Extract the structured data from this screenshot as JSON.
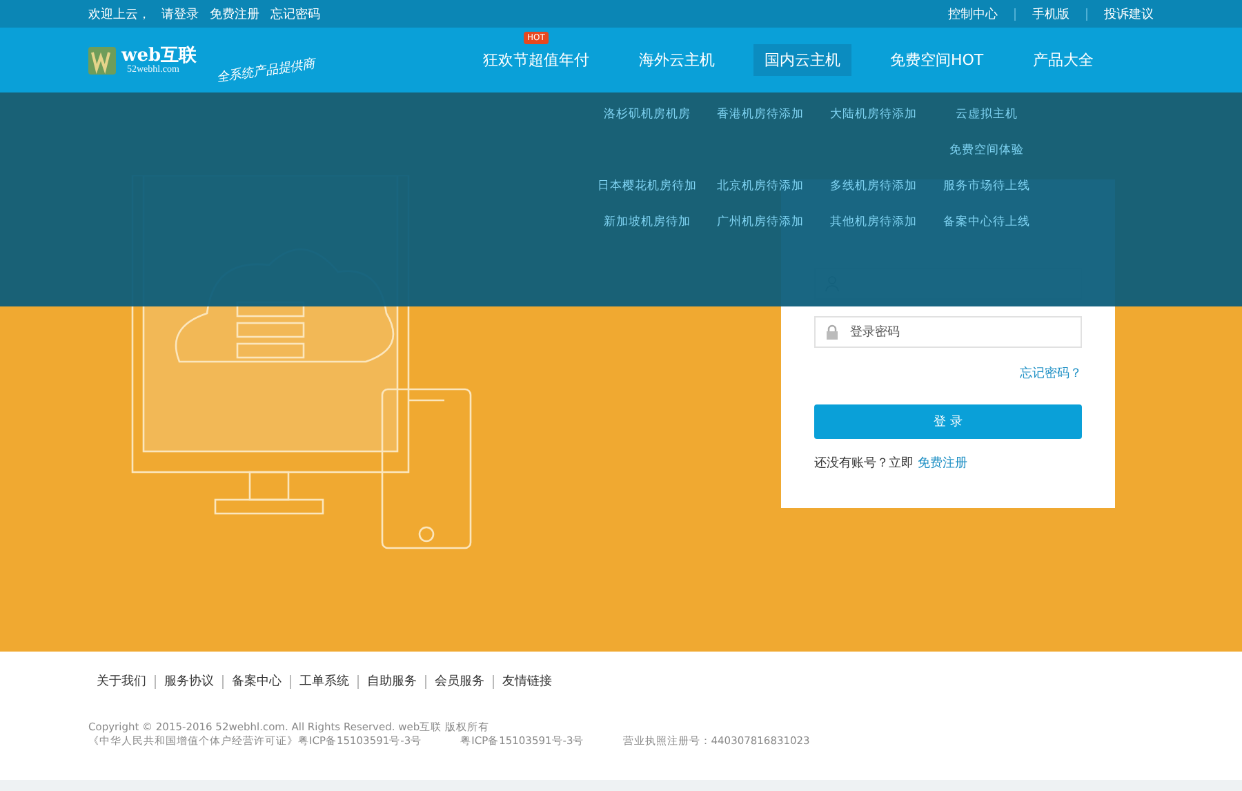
{
  "top_bar": {
    "left_links": [
      "欢迎上云，",
      "请登录",
      "免费注册",
      "忘记密码"
    ],
    "right_links": [
      "控制中心",
      "手机版",
      "投诉建议"
    ]
  },
  "header": {
    "logo": {
      "name": "web互联",
      "domain": "52webhl.com"
    },
    "slogan": "全系统产品提供商",
    "nav": [
      {
        "label": "狂欢节超值年付",
        "badge": "HOT",
        "selected": false
      },
      {
        "label": "海外云主机",
        "selected": false
      },
      {
        "label": "国内云主机",
        "selected": true
      },
      {
        "label": "免费空间HOT",
        "selected": false
      },
      {
        "label": "产品大全",
        "selected": false
      }
    ]
  },
  "dropdown_menu": {
    "rows": [
      [
        "洛杉矶机房机房",
        "香港机房待添加",
        "大陆机房待添加",
        "云虚拟主机"
      ],
      [
        null,
        null,
        null,
        "免费空间体验"
      ],
      [
        "日本樱花机房待加",
        "北京机房待添加",
        "多线机房待添加",
        "服务市场待上线"
      ],
      [
        "新加坡机房待加",
        "广州机房待添加",
        "其他机房待添加",
        "备案中心待上线"
      ]
    ]
  },
  "login_card": {
    "password": {
      "placeholder": "登录密码"
    },
    "forgot_link": "忘记密码？",
    "submit": "登 录",
    "register_prompt": "还没有账号？立即",
    "register_link": "免费注册"
  },
  "footer": {
    "links": [
      "关于我们",
      "服务协议",
      "备案中心",
      "工单系统",
      "自助服务",
      "会员服务",
      "友情链接"
    ],
    "copyright": "Copyright © 2015-2016 52webhl.com. All Rights Reserved. web互联 版权所有",
    "licenses": [
      "《中华人民共和国增值个体户经营许可证》粤ICP备15103591号-3号",
      "粤ICP备15103591号-3号",
      "营业执照注册号：440307816831023"
    ]
  }
}
